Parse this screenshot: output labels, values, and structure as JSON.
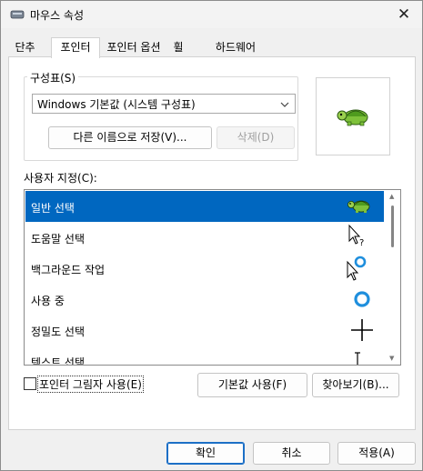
{
  "window": {
    "title": "마우스 속성",
    "close_glyph": "✕"
  },
  "tabs": [
    {
      "label": "단추",
      "active": false
    },
    {
      "label": "포인터",
      "active": true
    },
    {
      "label": "포인터 옵션",
      "active": false
    },
    {
      "label": "휠",
      "active": false
    },
    {
      "label": "하드웨어",
      "active": false
    }
  ],
  "scheme": {
    "group_label": "구성표(S)",
    "selected": "Windows 기본값 (시스템 구성표)",
    "save_as_label": "다른 이름으로 저장(V)...",
    "delete_label": "삭제(D)"
  },
  "customize": {
    "label": "사용자 지정(C):",
    "items": [
      {
        "label": "일반 선택",
        "cursor": "turtle-icon",
        "selected": true
      },
      {
        "label": "도움말 선택",
        "cursor": "help-select-cursor-icon",
        "selected": false
      },
      {
        "label": "백그라운드 작업",
        "cursor": "working-in-background-cursor-icon",
        "selected": false
      },
      {
        "label": "사용 중",
        "cursor": "busy-ring-cursor-icon",
        "selected": false
      },
      {
        "label": "정밀도 선택",
        "cursor": "precision-crosshair-cursor-icon",
        "selected": false
      },
      {
        "label": "텍스트 선택",
        "cursor": "text-ibeam-cursor-icon",
        "selected": false
      }
    ]
  },
  "shadow": {
    "label": "포인터 그림자 사용(E)",
    "checked": false
  },
  "buttons": {
    "use_default": "기본값 사용(F)",
    "browse": "찾아보기(B)...",
    "ok": "확인",
    "cancel": "취소",
    "apply": "적용(A)"
  },
  "colors": {
    "selection": "#0067c0",
    "accent": "#1c6fc6"
  }
}
